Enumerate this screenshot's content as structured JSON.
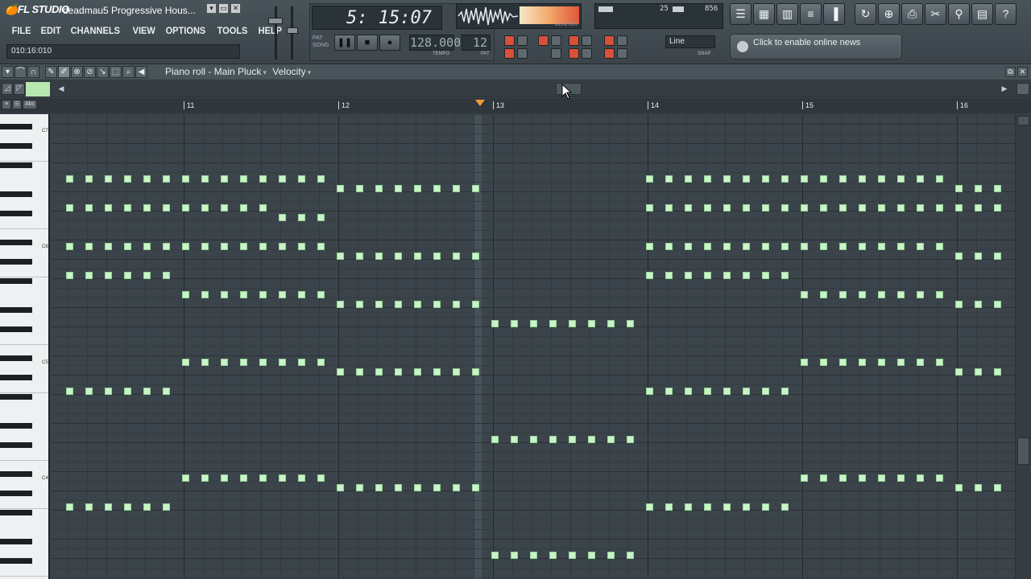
{
  "app": {
    "logo": "FL STUDIO",
    "window_title": "deadmau5 Progressive Hous...",
    "win_buttons": [
      "▾",
      "▭",
      "✕"
    ]
  },
  "menu": [
    "FILE",
    "EDIT",
    "CHANNELS",
    "VIEW",
    "OPTIONS",
    "TOOLS",
    "HELP"
  ],
  "hint_bar": "010:16:010",
  "transport": {
    "time": "5: 15:07",
    "pat_label": "PAT",
    "song_label": "SONG",
    "tempo": "128.000",
    "tempo_label": "TEMPO",
    "pattern": "12",
    "pattern_label": "PAT",
    "monitor_label": "MONITOR"
  },
  "cpu": {
    "ram": "25",
    "poly": "856",
    "poly_small": "4"
  },
  "snap": {
    "value": "Line",
    "label": "SNAP"
  },
  "news": "Click to enable online news",
  "piano_roll": {
    "title": "Piano roll - Main Pluck",
    "param": "Velocity",
    "bar_labels": [
      "11",
      "12",
      "13",
      "14",
      "15",
      "16"
    ],
    "octave_labels": [
      "C7",
      "C6",
      "C5",
      "C4"
    ]
  },
  "colors": {
    "note": "#c8f5c8",
    "playhead": "#f29a3a",
    "background": "#3b444a"
  }
}
